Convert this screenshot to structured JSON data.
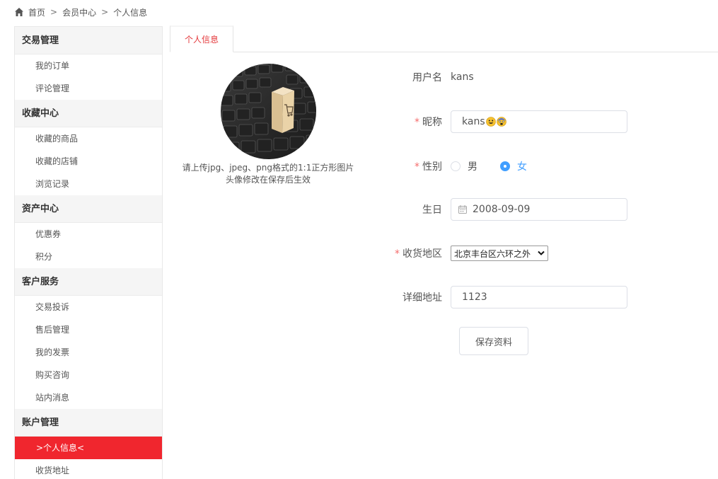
{
  "breadcrumb": {
    "home": "首页",
    "sep": ">",
    "member": "会员中心",
    "current": "个人信息"
  },
  "sidebar": {
    "groups": [
      {
        "title": "交易管理",
        "items": [
          "我的订单",
          "评论管理"
        ]
      },
      {
        "title": "收藏中心",
        "items": [
          "收藏的商品",
          "收藏的店铺",
          "浏览记录"
        ]
      },
      {
        "title": "资产中心",
        "items": [
          "优惠券",
          "积分"
        ]
      },
      {
        "title": "客户服务",
        "items": [
          "交易投诉",
          "售后管理",
          "我的发票",
          "购买咨询",
          "站内消息"
        ]
      },
      {
        "title": "账户管理",
        "items": [
          ">个人信息<",
          "收货地址"
        ]
      }
    ],
    "active_item": ">个人信息<"
  },
  "tabs": [
    {
      "label": "个人信息"
    }
  ],
  "avatar": {
    "hint_line1": "请上传jpg、jpeg、png格式的1:1正方形图片",
    "hint_line2": "头像修改在保存后生效"
  },
  "form": {
    "username": {
      "label": "用户名",
      "value": "kans"
    },
    "nickname": {
      "label": "昵称",
      "value": "kans",
      "emojis": [
        "grinning-face",
        "fearful-face"
      ],
      "required": "*"
    },
    "gender": {
      "label": "性别",
      "options": [
        "男",
        "女"
      ],
      "selected": "女",
      "required": "*"
    },
    "birthday": {
      "label": "生日",
      "value": "2008-09-09"
    },
    "region": {
      "label": "收货地区",
      "value": "北京丰台区六环之外",
      "required": "*"
    },
    "address": {
      "label": "详细地址",
      "value": "1123"
    },
    "save_label": "保存资料"
  },
  "colors": {
    "accent": "#f0262e",
    "tab_text": "#e4393c",
    "radio_checked": "#409eff",
    "required": "#f56c6c"
  }
}
